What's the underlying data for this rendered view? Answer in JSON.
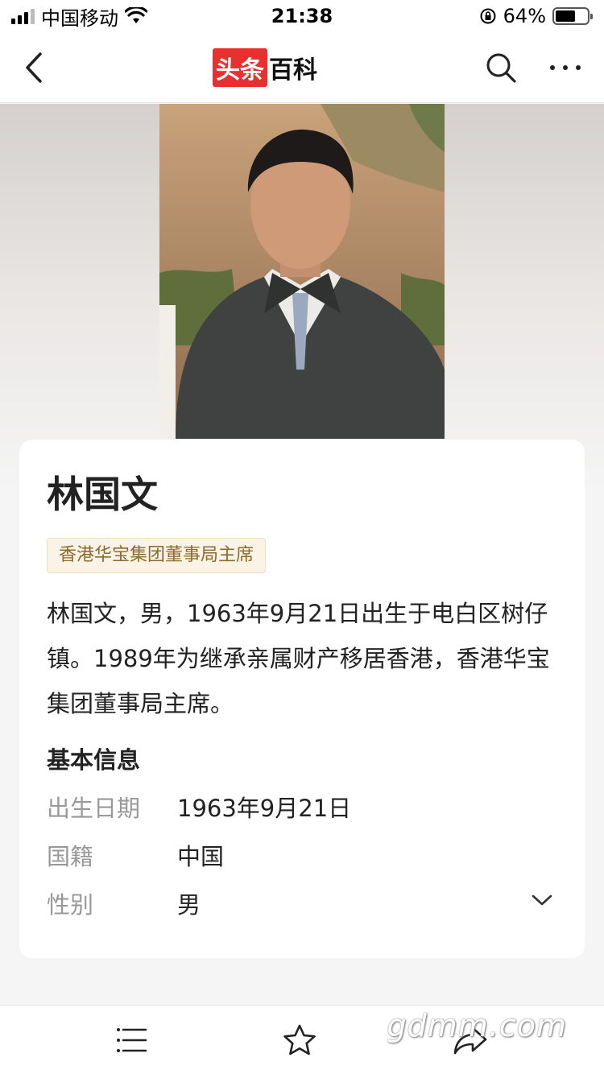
{
  "status": {
    "carrier": "中国移动",
    "time": "21:38",
    "battery": "64%",
    "battery_level": 0.64,
    "icons": [
      "signal-icon",
      "wifi-icon",
      "rotation-lock-icon",
      "battery-icon"
    ]
  },
  "nav": {
    "logo_part1": "头条",
    "logo_part2": "百科",
    "icons": [
      "back-arrow-icon",
      "search-icon",
      "more-dots-icon"
    ]
  },
  "person": {
    "name": "林国文",
    "tag": "香港华宝集团董事局主席",
    "summary": "林国文，男，1963年9月21日出生于电白区树仔镇。1989年为继承亲属财产移居香港，香港华宝集团董事局主席。"
  },
  "basic_info": {
    "title": "基本信息",
    "rows": [
      {
        "label": "出生日期",
        "value": "1963年9月21日"
      },
      {
        "label": "国籍",
        "value": "中国"
      },
      {
        "label": "性别",
        "value": "男"
      }
    ]
  },
  "bottom_bar": {
    "icons": [
      "catalog-list-icon",
      "favorite-star-icon",
      "share-arrow-icon"
    ]
  },
  "watermark": "gdmm.com",
  "colors": {
    "logo_red": "#e8312f",
    "tag_bg": "#fbf4e6",
    "tag_text": "#8a6a2f",
    "label_gray": "#999999"
  }
}
